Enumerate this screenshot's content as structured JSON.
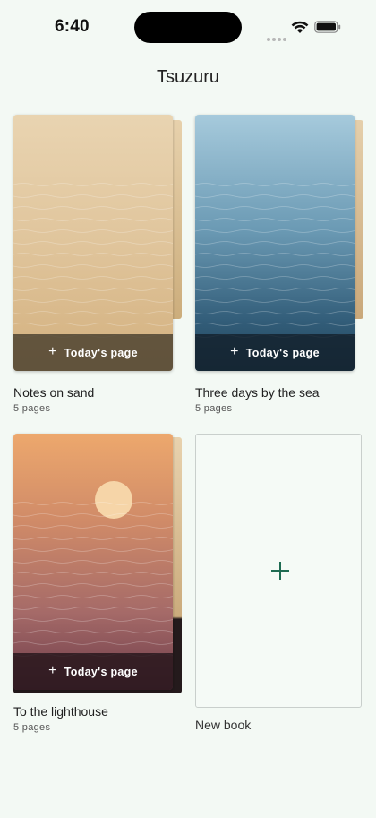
{
  "status_bar": {
    "time": "6:40"
  },
  "app": {
    "title": "Tsuzuru"
  },
  "books": [
    {
      "title": "Notes on sand",
      "pages": "5 pages",
      "action_label": "Today's page"
    },
    {
      "title": "Three days by the sea",
      "pages": "5 pages",
      "action_label": "Today's page"
    },
    {
      "title": "To the lighthouse",
      "pages": "5 pages",
      "action_label": "Today's page"
    }
  ],
  "new_book": {
    "label": "New book"
  },
  "colors": {
    "accent": "#1e6b52",
    "background": "#f3f9f4"
  },
  "icons": [
    "wifi-icon",
    "battery-icon",
    "plus-icon"
  ]
}
